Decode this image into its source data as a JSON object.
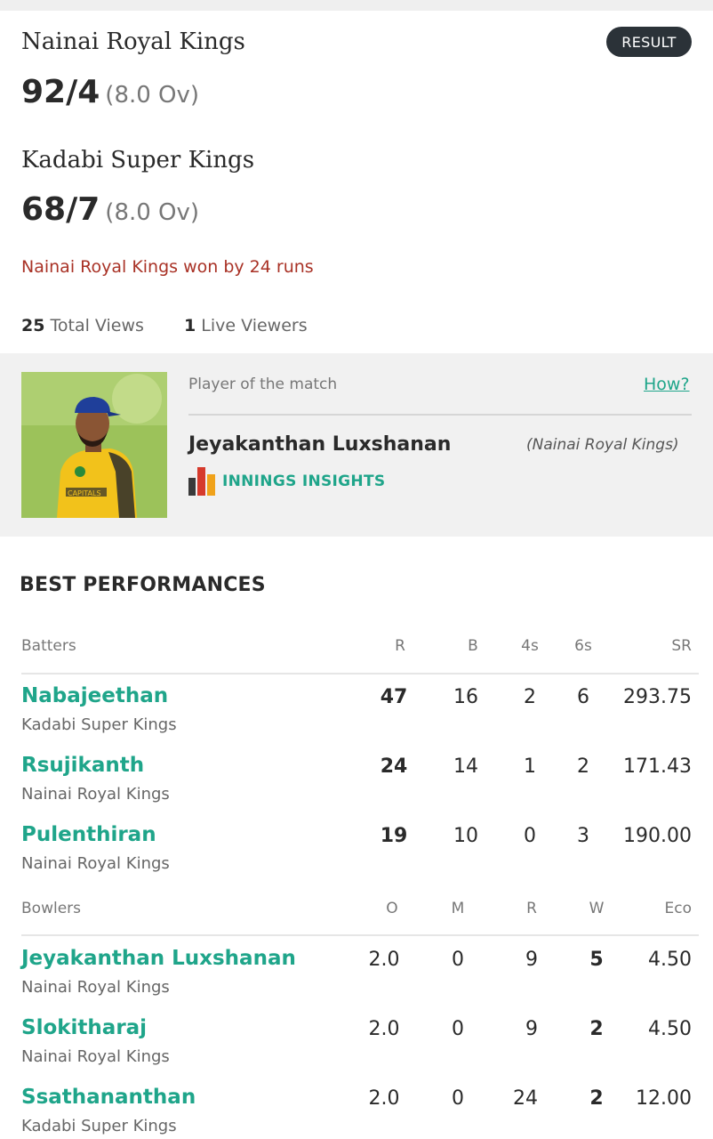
{
  "match": {
    "status_badge": "RESULT",
    "team1": {
      "name": "Nainai Royal Kings",
      "score": "92/4",
      "overs": "(8.0 Ov)"
    },
    "team2": {
      "name": "Kadabi Super Kings",
      "score": "68/7",
      "overs": "(8.0 Ov)"
    },
    "result": "Nainai Royal Kings won by 24 runs",
    "total_views_count": "25",
    "total_views_label": "Total Views",
    "live_viewers_count": "1",
    "live_viewers_label": "Live Viewers"
  },
  "player_of_match": {
    "label": "Player of the match",
    "how_link": "How?",
    "name": "Jeyakanthan Luxshanan",
    "team": "(Nainai Royal Kings)",
    "insights_label": "INNINGS INSIGHTS",
    "jersey_text": "CAPITALS"
  },
  "best_performances": {
    "title": "BEST PERFORMANCES",
    "batters": {
      "headers": [
        "Batters",
        "R",
        "B",
        "4s",
        "6s",
        "SR"
      ],
      "rows": [
        {
          "name": "Nabajeethan",
          "team": "Kadabi Super Kings",
          "r": "47",
          "b": "16",
          "fours": "2",
          "sixes": "6",
          "sr": "293.75"
        },
        {
          "name": "Rsujikanth",
          "team": "Nainai Royal Kings",
          "r": "24",
          "b": "14",
          "fours": "1",
          "sixes": "2",
          "sr": "171.43"
        },
        {
          "name": "Pulenthiran",
          "team": "Nainai Royal Kings",
          "r": "19",
          "b": "10",
          "fours": "0",
          "sixes": "3",
          "sr": "190.00"
        }
      ]
    },
    "bowlers": {
      "headers": [
        "Bowlers",
        "O",
        "M",
        "R",
        "W",
        "Eco"
      ],
      "rows": [
        {
          "name": "Jeyakanthan Luxshanan",
          "team": "Nainai Royal Kings",
          "o": "2.0",
          "m": "0",
          "r": "9",
          "w": "5",
          "eco": "4.50"
        },
        {
          "name": "Slokitharaj",
          "team": "Nainai Royal Kings",
          "o": "2.0",
          "m": "0",
          "r": "9",
          "w": "2",
          "eco": "4.50"
        },
        {
          "name": "Ssathananthan",
          "team": "Kadabi Super Kings",
          "o": "2.0",
          "m": "0",
          "r": "24",
          "w": "2",
          "eco": "12.00"
        }
      ]
    }
  },
  "colors": {
    "accent": "#1fa58a",
    "result": "#a93226",
    "badge_bg": "#2b3238",
    "panel_bg": "#f1f1f1"
  },
  "icons": {
    "insights": "bar-chart-icon"
  }
}
